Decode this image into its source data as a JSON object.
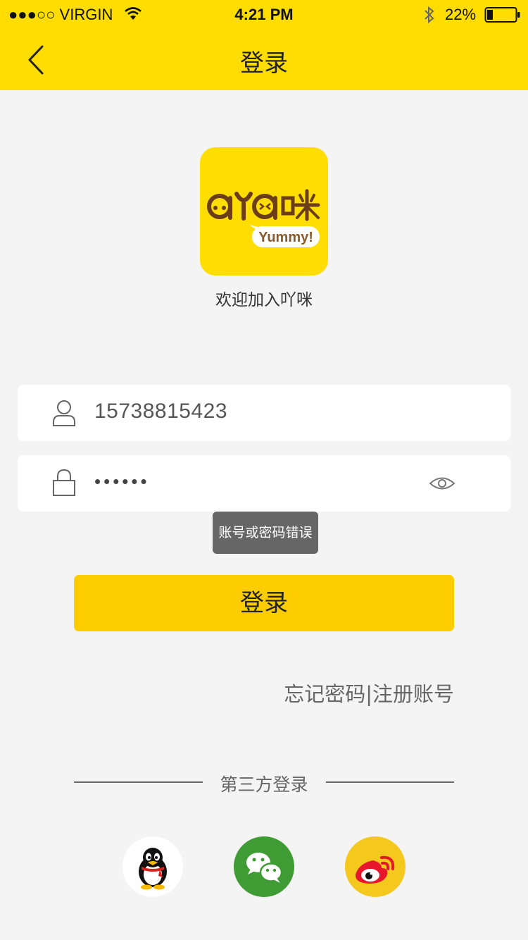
{
  "status_bar": {
    "carrier": "●●●○○ VIRGIN",
    "time": "4:21 PM",
    "battery": "22%"
  },
  "header": {
    "title": "登录"
  },
  "logo": {
    "badge": "Yummy!"
  },
  "welcome": "欢迎加入吖咪",
  "form": {
    "phone_value": "15738815423",
    "password_value": "••••••",
    "error_toast": "账号或密码错误",
    "login_label": "登录"
  },
  "links": {
    "forgot": "忘记密码",
    "separator": "|",
    "register": "注册账号"
  },
  "third_party": {
    "label": "第三方登录",
    "providers": [
      "qq-icon",
      "wechat-icon",
      "weibo-icon"
    ]
  },
  "colors": {
    "brand_yellow": "#ffdd00",
    "button_yellow": "#fecd00",
    "toast_gray": "#666666",
    "wechat_green": "#3f9b33",
    "weibo_yellow": "#f4c81c"
  }
}
